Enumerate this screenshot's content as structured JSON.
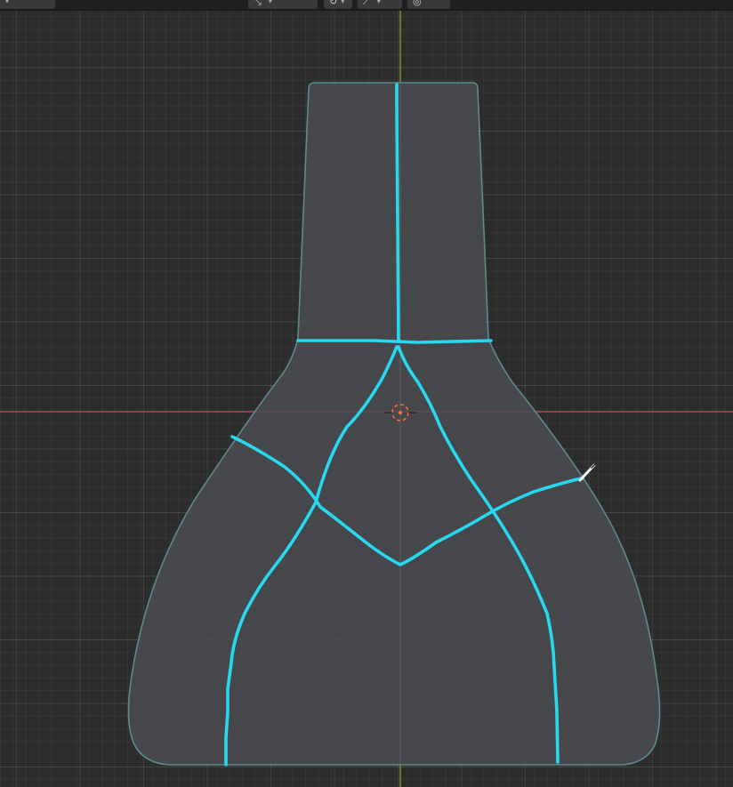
{
  "header": {
    "items": [
      {
        "label": "",
        "has_dropdown": true
      },
      {
        "label": "",
        "has_dropdown": true
      },
      {
        "label": "",
        "has_dropdown": true
      },
      {
        "label": "",
        "has_dropdown": true
      },
      {
        "label": "",
        "has_dropdown": false
      }
    ]
  },
  "viewport": {
    "axis_x_color": "#c9465f",
    "axis_y_color": "#9aa63a",
    "mesh_fill": "#4a4d52",
    "mesh_outline": "#5e8a8c",
    "stroke_color": "#27d8ee",
    "cursor_color": "#ff6b3d"
  }
}
